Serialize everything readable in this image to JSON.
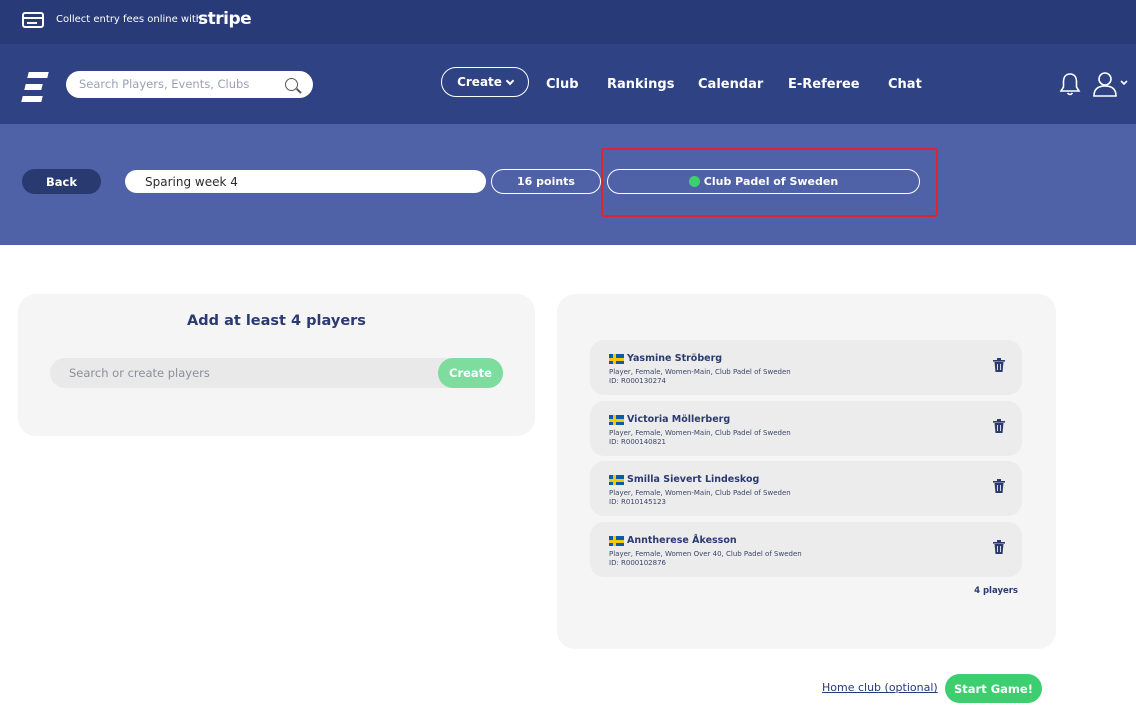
{
  "promo": {
    "text": "Collect entry fees online with",
    "brand": "stripe"
  },
  "nav": {
    "search_placeholder": "Search Players, Events, Clubs",
    "create_label": "Create",
    "links": [
      "Club",
      "Rankings",
      "Calendar",
      "E-Referee",
      "Chat"
    ]
  },
  "header": {
    "back_label": "Back",
    "game_title": "Sparing week 4",
    "points": "16 points",
    "club": "Club Padel of Sweden"
  },
  "left_panel": {
    "title": "Add at least 4 players",
    "search_placeholder": "Search or create players",
    "create_label": "Create"
  },
  "players": [
    {
      "name": "Yasmine Ströberg",
      "desc": "Player, Female, Women-Main, Club Padel of Sweden",
      "id": "ID: R000130274"
    },
    {
      "name": "Victoria Möllerberg",
      "desc": "Player, Female, Women-Main, Club Padel of Sweden",
      "id": "ID: R000140821"
    },
    {
      "name": "Smilla Sievert Lindeskog",
      "desc": "Player, Female, Women-Main, Club Padel of Sweden",
      "id": "ID: R010145123"
    },
    {
      "name": "Anntherese Åkesson",
      "desc": "Player, Female, Women Over 40, Club Padel of Sweden",
      "id": "ID: R000102876"
    }
  ],
  "player_count": "4 players",
  "footer": {
    "home_club": "Home club (optional)",
    "start_label": "Start Game!"
  },
  "colors": {
    "nav": "#2f4283",
    "promo": "#283a78",
    "subheader": "#4f62a7",
    "accent_green": "#3dcf6f",
    "highlight": "#e0242f"
  }
}
